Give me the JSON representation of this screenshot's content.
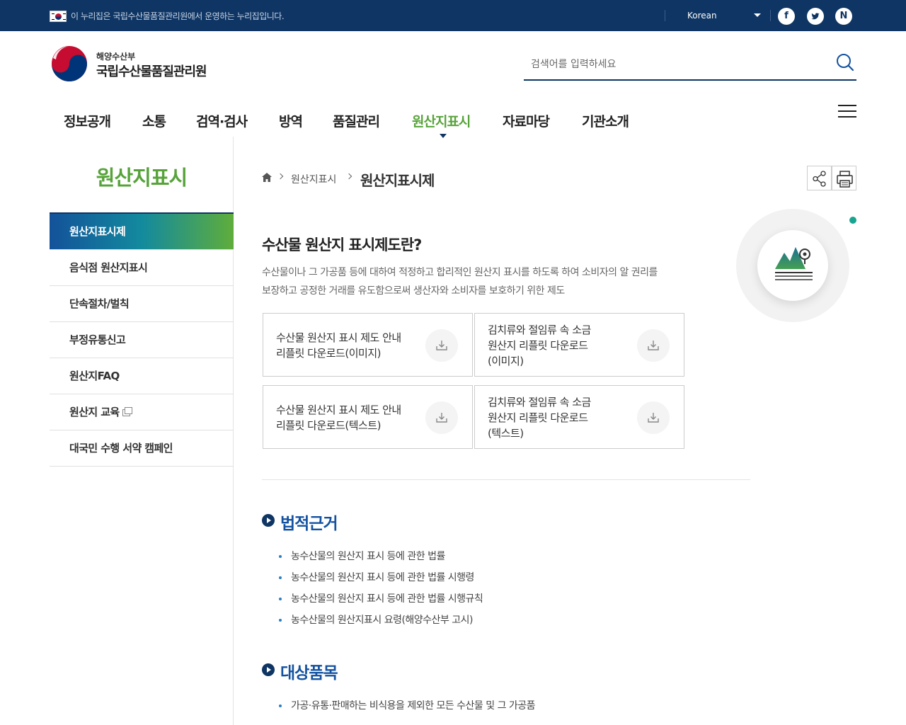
{
  "topbar": {
    "notice": "이 누리집은 국립수산물품질관리원에서 운영하는 누리집입니다.",
    "language": "Korean",
    "sns": [
      {
        "name": "facebook",
        "glyph": "f"
      },
      {
        "name": "twitter",
        "glyph": "t"
      },
      {
        "name": "naver-blog",
        "glyph": "N"
      }
    ]
  },
  "header": {
    "org_parent": "해양수산부",
    "org_name": "국립수산물품질관리원",
    "search_placeholder": "검색어를 입력하세요"
  },
  "gnb": {
    "items": [
      "정보공개",
      "소통",
      "검역·검사",
      "방역",
      "품질관리",
      "원산지표시",
      "자료마당",
      "기관소개"
    ],
    "active": "원산지표시"
  },
  "sidebar": {
    "title": "원산지표시",
    "items": [
      {
        "label": "원산지표시제",
        "active": true
      },
      {
        "label": "음식점 원산지표시"
      },
      {
        "label": "단속절차/벌칙"
      },
      {
        "label": "부정유통신고"
      },
      {
        "label": "원산지FAQ"
      },
      {
        "label": "원산지 교육",
        "new_window": true
      },
      {
        "label": "대국민 수행 서약 캠페인"
      }
    ]
  },
  "breadcrumb": {
    "level1": "원산지표시",
    "current": "원산지표시제"
  },
  "content": {
    "title": "수산물 원산지 표시제도란?",
    "desc_line1": "수산물이나 그 가공품 등에 대하여 적정하고 합리적인 원산지 표시를 하도록 하여 소비자의 알 권리를",
    "desc_line2": "보장하고 공정한 거래를 유도함으로써 생산자와 소비자를 보호하기 위한 제도",
    "downloads": [
      {
        "line1": "수산물 원산지 표시 제도 안내",
        "line2": "리플릿 다운로드(이미지)",
        "line3": ""
      },
      {
        "line1": "김치류와 절임류 속 소금",
        "line2": "원산지 리플릿 다운로드",
        "line3": "(이미지)"
      },
      {
        "line1": "수산물 원산지 표시 제도 안내",
        "line2": "리플릿 다운로드(텍스트)",
        "line3": ""
      },
      {
        "line1": "김치류와 절임류 속 소금",
        "line2": "원산지 리플릿 다운로드",
        "line3": "(텍스트)"
      }
    ],
    "section1": {
      "title": "법적근거",
      "items": [
        "농수산물의 원산지 표시 등에 관한 법률",
        "농수산물의 원산지 표시 등에 관한 법률 시행령",
        "농수산물의 원산지 표시 등에 관한 법률 시행규칙",
        "농수산물의 원산지표시 요령(해양수산부 고시)"
      ]
    },
    "section2": {
      "title": "대상품목",
      "items": [
        "가공·유통·판매하는 비식용을 제외한 모든 수산물 및 그 가공품"
      ]
    }
  },
  "colors": {
    "topbar": "#0e3563",
    "accent_green": "#57a33a",
    "section_blue": "#1452a0",
    "dot_teal": "#18a590"
  }
}
